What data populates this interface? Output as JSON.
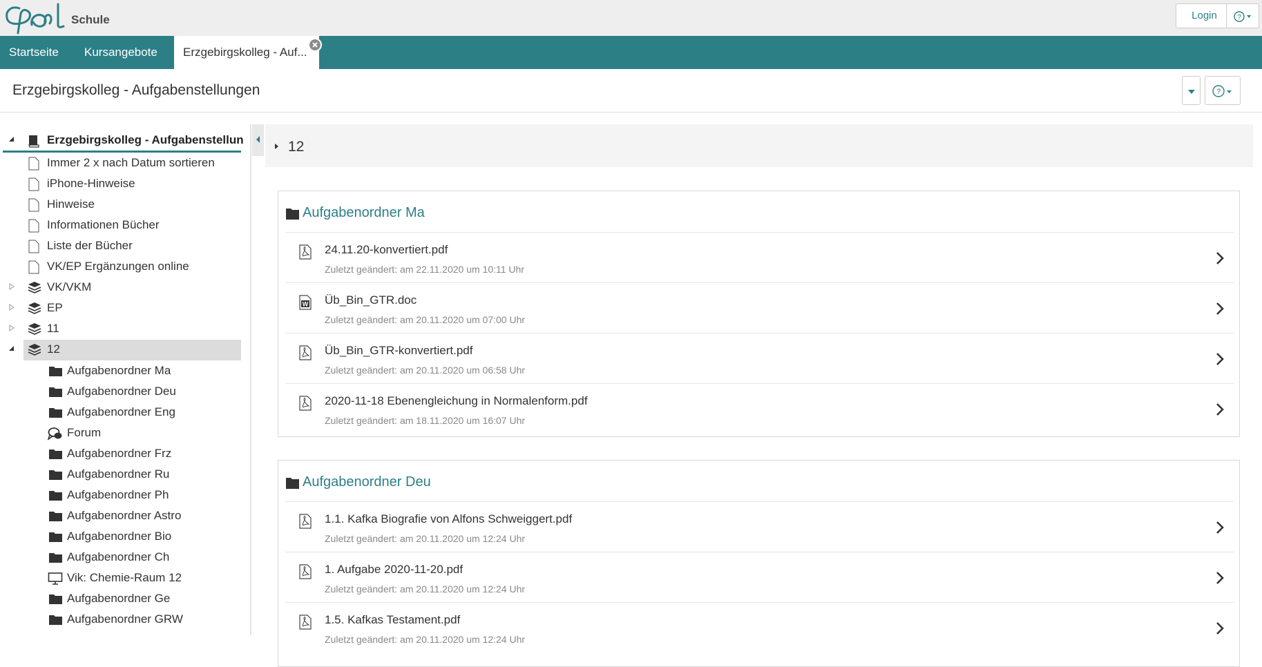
{
  "app": {
    "logo_text": "Opal",
    "logo_sub": "Schule",
    "login_label": "Login",
    "colors": {
      "brand": "#2d7f86",
      "tabbar": "#2d7f86",
      "topbar": "#eeeeee"
    }
  },
  "tabs": [
    {
      "label": "Startseite",
      "icon": "none"
    },
    {
      "label": "Kursangebote",
      "icon": "none"
    },
    {
      "label": "Erzgebirgskolleg - Auf...",
      "icon": "close-icon",
      "active": true
    }
  ],
  "course": {
    "title": "Erzgebirgskolleg - Aufgabenstellungen"
  },
  "tree": {
    "root": {
      "label": "Erzgebirgskolleg - Aufgabenstellun",
      "icon": "book-icon"
    },
    "items": [
      {
        "label": "Immer 2 x nach Datum sortieren",
        "icon": "page-icon",
        "level": 1
      },
      {
        "label": "iPhone-Hinweise",
        "icon": "page-icon",
        "level": 1
      },
      {
        "label": "Hinweise",
        "icon": "page-icon",
        "level": 1
      },
      {
        "label": "Informationen Bücher",
        "icon": "page-icon",
        "level": 1
      },
      {
        "label": "Liste der Bücher",
        "icon": "page-icon",
        "level": 1
      },
      {
        "label": "VK/EP Ergänzungen online",
        "icon": "page-icon",
        "level": 1
      },
      {
        "label": "VK/VKM",
        "icon": "layers-icon",
        "level": 1,
        "toggle": "collapsed"
      },
      {
        "label": "EP",
        "icon": "layers-icon",
        "level": 1,
        "toggle": "collapsed"
      },
      {
        "label": "11",
        "icon": "layers-icon",
        "level": 1,
        "toggle": "collapsed"
      },
      {
        "label": "12",
        "icon": "layers-icon",
        "level": 1,
        "toggle": "expanded",
        "selected": true
      },
      {
        "label": "Aufgabenordner Ma",
        "icon": "folder-icon",
        "level": 2
      },
      {
        "label": "Aufgabenordner Deu",
        "icon": "folder-icon",
        "level": 2
      },
      {
        "label": "Aufgabenordner Eng",
        "icon": "folder-icon",
        "level": 2
      },
      {
        "label": "Forum",
        "icon": "forum-icon",
        "level": 2
      },
      {
        "label": "Aufgabenordner Frz",
        "icon": "folder-icon",
        "level": 2
      },
      {
        "label": "Aufgabenordner Ru",
        "icon": "folder-icon",
        "level": 2
      },
      {
        "label": "Aufgabenordner Ph",
        "icon": "folder-icon",
        "level": 2
      },
      {
        "label": "Aufgabenordner Astro",
        "icon": "folder-icon",
        "level": 2
      },
      {
        "label": "Aufgabenordner Bio",
        "icon": "folder-icon",
        "level": 2
      },
      {
        "label": "Aufgabenordner Ch",
        "icon": "folder-icon",
        "level": 2
      },
      {
        "label": "Vik: Chemie-Raum 12",
        "icon": "monitor-icon",
        "level": 2
      },
      {
        "label": "Aufgabenordner Ge",
        "icon": "folder-icon",
        "level": 2
      },
      {
        "label": "Aufgabenordner GRW",
        "icon": "folder-icon",
        "level": 2
      }
    ]
  },
  "content": {
    "section_label": "12",
    "panels": [
      {
        "title": "Aufgabenordner Ma",
        "files": [
          {
            "name": "24.11.20-konvertiert.pdf",
            "modified": "Zuletzt geändert: am 22.11.2020 um 10:11 Uhr",
            "icon": "pdf-icon"
          },
          {
            "name": "Üb_Bin_GTR.doc",
            "modified": "Zuletzt geändert: am 20.11.2020 um 07:00 Uhr",
            "icon": "word-icon"
          },
          {
            "name": "Üb_Bin_GTR-konvertiert.pdf",
            "modified": "Zuletzt geändert: am 20.11.2020 um 06:58 Uhr",
            "icon": "pdf-icon"
          },
          {
            "name": "2020-11-18 Ebenengleichung in Normalenform.pdf",
            "modified": "Zuletzt geändert: am 18.11.2020 um 16:07 Uhr",
            "icon": "pdf-icon"
          }
        ]
      },
      {
        "title": "Aufgabenordner Deu",
        "files": [
          {
            "name": "1.1. Kafka Biografie von Alfons Schweiggert.pdf",
            "modified": "Zuletzt geändert: am 20.11.2020 um 12:24 Uhr",
            "icon": "pdf-icon"
          },
          {
            "name": "1. Aufgabe 2020-11-20.pdf",
            "modified": "Zuletzt geändert: am 20.11.2020 um 12:24 Uhr",
            "icon": "pdf-icon"
          },
          {
            "name": "1.5. Kafkas Testament.pdf",
            "modified": "Zuletzt geändert: am 20.11.2020 um 12:24 Uhr",
            "icon": "pdf-icon"
          }
        ]
      }
    ]
  }
}
